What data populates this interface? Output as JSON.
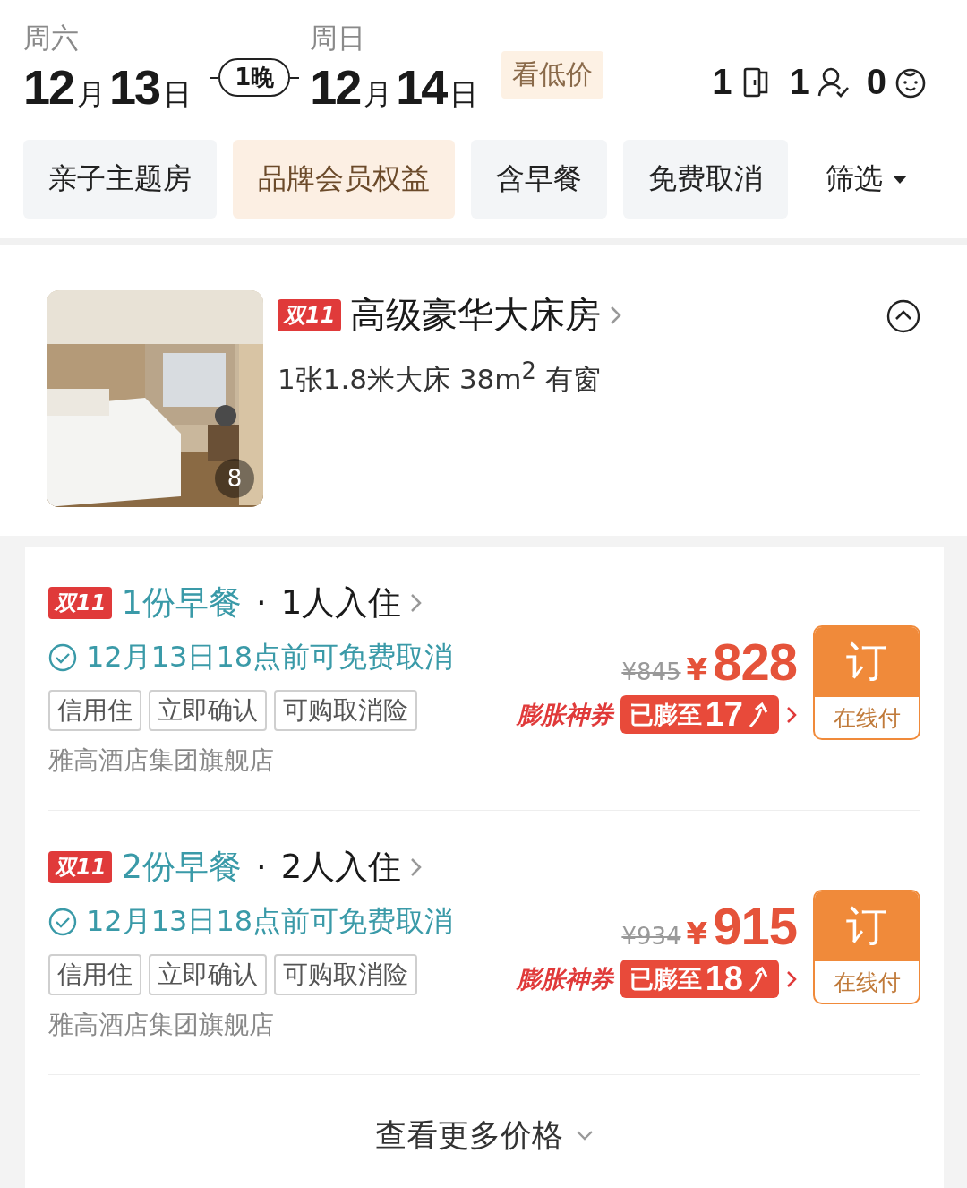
{
  "stay": {
    "checkin": {
      "weekday": "周六",
      "date_parts": [
        "12",
        "月",
        "13",
        "日"
      ]
    },
    "nights": "1晚",
    "checkout": {
      "weekday": "周日",
      "date_parts": [
        "12",
        "月",
        "14",
        "日"
      ]
    },
    "low_price_tag": "看低价",
    "guests": [
      {
        "kind": "room",
        "count": "1"
      },
      {
        "kind": "adult",
        "count": "1"
      },
      {
        "kind": "child",
        "count": "0"
      }
    ]
  },
  "filters": [
    {
      "label": "亲子主题房",
      "selected": false,
      "kind": "chip"
    },
    {
      "label": "品牌会员权益",
      "selected": true,
      "kind": "chip"
    },
    {
      "label": "含早餐",
      "selected": false,
      "kind": "chip"
    },
    {
      "label": "免费取消",
      "selected": false,
      "kind": "chip"
    },
    {
      "label": "筛选",
      "kind": "dropdown"
    }
  ],
  "room": {
    "photo": {
      "kind": "picture",
      "count": "8"
    },
    "badge": "双11",
    "name": "高级豪华大床房",
    "specs": "1张1.8米大床  38m$^{2}$  有窗",
    "expanded": true
  },
  "rates": [
    {
      "badge": "双11",
      "breakfast": "1份早餐",
      "separator": "·",
      "occupancy": "1人入住",
      "cancellation": "12月13日18点前可免费取消",
      "tags": [
        "信用住",
        "立即确认",
        "可购取消险"
      ],
      "seller": "雅高酒店集团旗舰店",
      "original_price": "¥845",
      "currency": "¥",
      "price": "828",
      "coupon_label": "膨胀神券",
      "coupon_text": "已膨至",
      "coupon_value": "17",
      "book_label": "订",
      "pay_label": "在线付"
    },
    {
      "badge": "双11",
      "breakfast": "2份早餐",
      "separator": "·",
      "occupancy": "2人入住",
      "cancellation": "12月13日18点前可免费取消",
      "tags": [
        "信用住",
        "立即确认",
        "可购取消险"
      ],
      "seller": "雅高酒店集团旗舰店",
      "original_price": "¥934",
      "currency": "¥",
      "price": "915",
      "coupon_label": "膨胀神券",
      "coupon_text": "已膨至",
      "coupon_value": "18",
      "book_label": "订",
      "pay_label": "在线付"
    }
  ],
  "more_prices": "查看更多价格"
}
